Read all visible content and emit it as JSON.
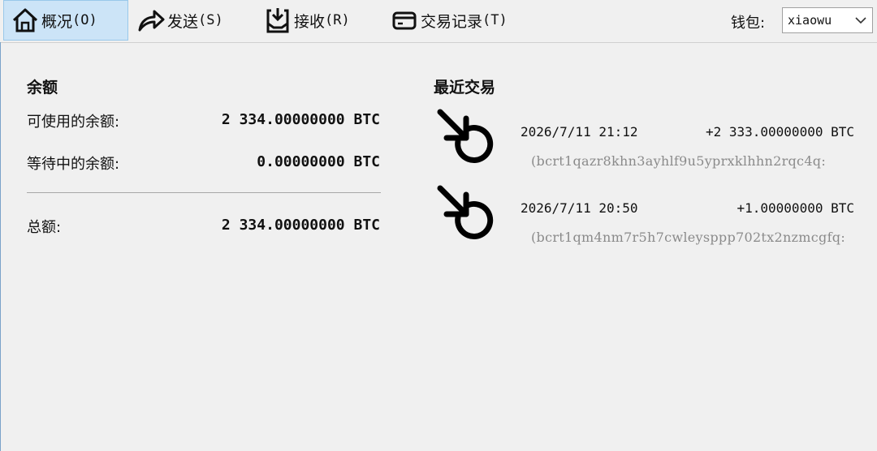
{
  "toolbar": {
    "tabs": [
      {
        "label_cn": "概况",
        "shortcut": "(O)",
        "icon": "home-icon",
        "active": true
      },
      {
        "label_cn": "发送",
        "shortcut": "(S)",
        "icon": "send-arrow-icon",
        "active": false
      },
      {
        "label_cn": "接收",
        "shortcut": "(R)",
        "icon": "receive-inbox-icon",
        "active": false
      },
      {
        "label_cn": "交易记录",
        "shortcut": "(T)",
        "icon": "card-icon",
        "active": false
      }
    ],
    "wallet_label": "钱包:",
    "wallet_selected": "xiaowu"
  },
  "balances": {
    "title": "余额",
    "available_label": "可使用的余额:",
    "available_value": "2 334.00000000 BTC",
    "pending_label": "等待中的余额:",
    "pending_value": "0.00000000 BTC",
    "total_label": "总额:",
    "total_value": "2 334.00000000 BTC"
  },
  "recent": {
    "title": "最近交易",
    "transactions": [
      {
        "icon": "incoming-tx-icon",
        "datetime": "2026/7/11 21:12",
        "amount": "+2 333.00000000 BTC",
        "address": "(bcrt1qazr8khn3ayhlf9u5yprxklhhn2rqc4q:"
      },
      {
        "icon": "incoming-tx-icon",
        "datetime": "2026/7/11 20:50",
        "amount": "+1.00000000 BTC",
        "address": "(bcrt1qm4nm7r5h7cwleysppp702tx2nzmcgfq:"
      }
    ]
  },
  "colors": {
    "active_tab_bg": "#cce4f7",
    "active_tab_border": "#99c8ea",
    "address_text": "#8a8a8a"
  }
}
